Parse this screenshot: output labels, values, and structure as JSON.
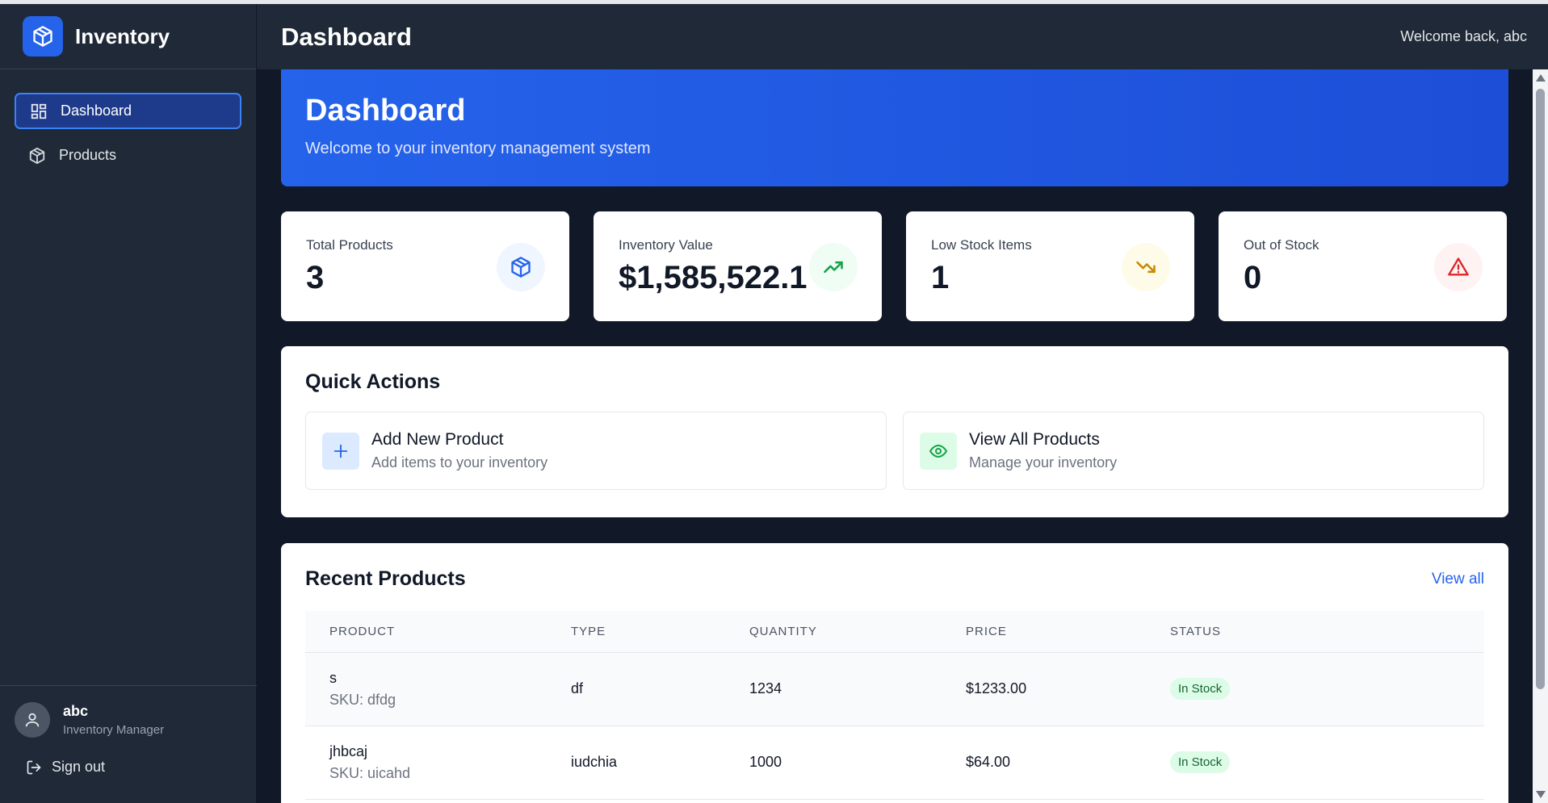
{
  "app": {
    "name": "Inventory"
  },
  "sidebar": {
    "items": [
      {
        "label": "Dashboard",
        "icon": "dashboard-grid-icon",
        "active": true
      },
      {
        "label": "Products",
        "icon": "box-icon",
        "active": false
      }
    ],
    "user": {
      "name": "abc",
      "role": "Inventory Manager"
    },
    "signout_label": "Sign out"
  },
  "header": {
    "title": "Dashboard",
    "welcome": "Welcome back, abc"
  },
  "hero": {
    "title": "Dashboard",
    "subtitle": "Welcome to your inventory management system"
  },
  "stats": [
    {
      "label": "Total Products",
      "value": "3",
      "icon": "box-icon",
      "color": "#2563eb"
    },
    {
      "label": "Inventory Value",
      "value": "$1,585,522.1",
      "icon": "trending-up-icon",
      "color": "#16a34a"
    },
    {
      "label": "Low Stock Items",
      "value": "1",
      "icon": "trending-down-icon",
      "color": "#ca8a04"
    },
    {
      "label": "Out of Stock",
      "value": "0",
      "icon": "alert-triangle-icon",
      "color": "#dc2626"
    }
  ],
  "quick_actions": {
    "title": "Quick Actions",
    "items": [
      {
        "title": "Add New Product",
        "subtitle": "Add items to your inventory",
        "icon": "plus-icon"
      },
      {
        "title": "View All Products",
        "subtitle": "Manage your inventory",
        "icon": "eye-icon"
      }
    ]
  },
  "recent_products": {
    "title": "Recent Products",
    "view_all_label": "View all",
    "columns": [
      "PRODUCT",
      "TYPE",
      "QUANTITY",
      "PRICE",
      "STATUS"
    ],
    "rows": [
      {
        "name": "s",
        "sku": "SKU: dfdg",
        "type": "df",
        "quantity": "1234",
        "price": "$1233.00",
        "status": "In Stock"
      },
      {
        "name": "jhbcaj",
        "sku": "SKU: uicahd",
        "type": "iudchia",
        "quantity": "1000",
        "price": "$64.00",
        "status": "In Stock"
      }
    ]
  }
}
